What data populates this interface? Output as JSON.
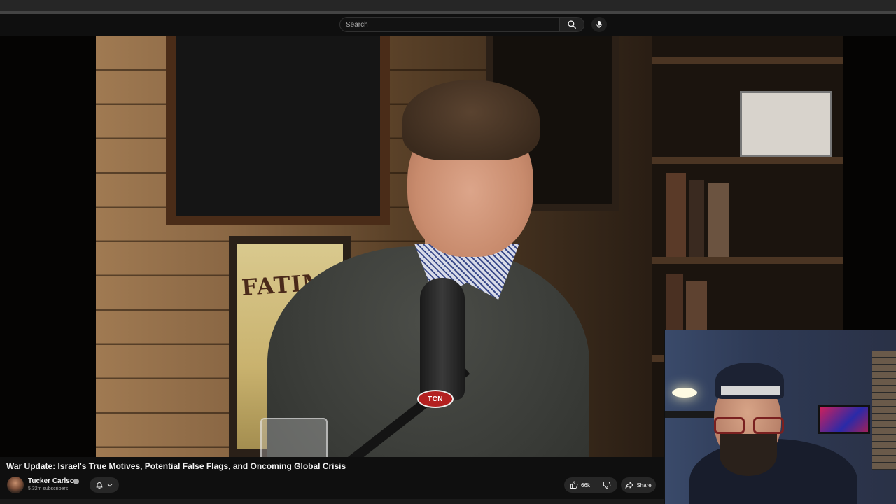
{
  "search": {
    "placeholder": "Search"
  },
  "player": {
    "poster_text": "FATIMA",
    "mic_badge": "TCN"
  },
  "video": {
    "title": "War Update: Israel's True Motives, Potential False Flags, and Oncoming Global Crisis"
  },
  "channel": {
    "name": "Tucker Carlson",
    "subscribers": "5.32m subscribers"
  },
  "actions": {
    "like_count": "66k",
    "share_label": "Share"
  },
  "icons": {
    "search": "search-icon",
    "mic": "mic-icon",
    "bell": "bell-icon",
    "chevron": "chevron-down-icon",
    "like": "thumbs-up-icon",
    "dislike": "thumbs-down-icon",
    "share": "share-icon",
    "verified": "verified-icon"
  }
}
